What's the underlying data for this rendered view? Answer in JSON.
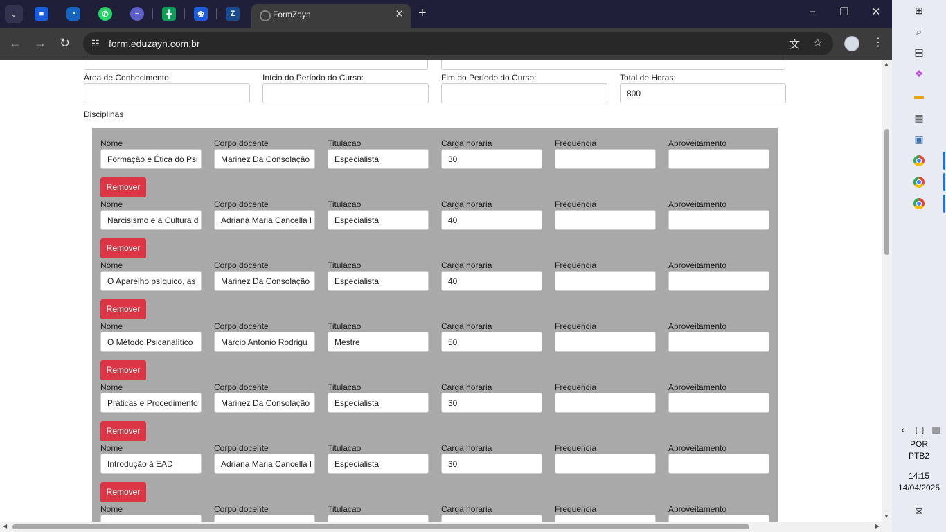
{
  "browser": {
    "tab_title": "FormZayn",
    "url": "form.eduzayn.com.br",
    "colors": {
      "titlebar": "#1f1f3a",
      "toolbar": "#3c3c3c",
      "accent": "#dc3545"
    },
    "pinned_tabs": [
      "bitwarden-icon",
      "edge-icon",
      "whatsapp-icon",
      "app-icon",
      "sheets-icon",
      "butterfly-icon",
      "zayn-icon"
    ]
  },
  "form": {
    "labels": {
      "area": "Área de Conhecimento:",
      "inicio": "Início do Período do Curso:",
      "fim": "Fim do Período do Curso:",
      "total": "Total de Horas:"
    },
    "values": {
      "area": "",
      "inicio": "",
      "fim": "",
      "total": "800"
    },
    "disciplinas_label": "Disciplinas",
    "columns": [
      "Nome",
      "Corpo docente",
      "Titulacao",
      "Carga horaria",
      "Frequencia",
      "Aproveitamento"
    ],
    "remove_label": "Remover",
    "rows": [
      {
        "nome": "Formação e Ética do Psi",
        "docente": "Marinez Da Consolação",
        "titulacao": "Especialista",
        "carga": "30",
        "frequencia": "",
        "aproveitamento": ""
      },
      {
        "nome": "Narcisismo e a Cultura d",
        "docente": "Adriana Maria Cancella l",
        "titulacao": "Especialista",
        "carga": "40",
        "frequencia": "",
        "aproveitamento": ""
      },
      {
        "nome": "O Aparelho psíquico, as",
        "docente": "Marinez Da Consolação",
        "titulacao": "Especialista",
        "carga": "40",
        "frequencia": "",
        "aproveitamento": ""
      },
      {
        "nome": "O Método Psicanalítico",
        "docente": "Marcio Antonio Rodrigu",
        "titulacao": "Mestre",
        "carga": "50",
        "frequencia": "",
        "aproveitamento": ""
      },
      {
        "nome": "Práticas e Procedimento",
        "docente": "Marinez Da Consolação",
        "titulacao": "Especialista",
        "carga": "30",
        "frequencia": "",
        "aproveitamento": ""
      },
      {
        "nome": "Introdução à EAD",
        "docente": "Adriana Maria Cancella l",
        "titulacao": "Especialista",
        "carga": "30",
        "frequencia": "",
        "aproveitamento": ""
      },
      {
        "nome": "",
        "docente": "",
        "titulacao": "",
        "carga": "",
        "frequencia": "",
        "aproveitamento": ""
      }
    ]
  },
  "taskbar": {
    "lang1": "POR",
    "lang2": "PTB2",
    "time": "14:15",
    "date": "14/04/2025"
  }
}
